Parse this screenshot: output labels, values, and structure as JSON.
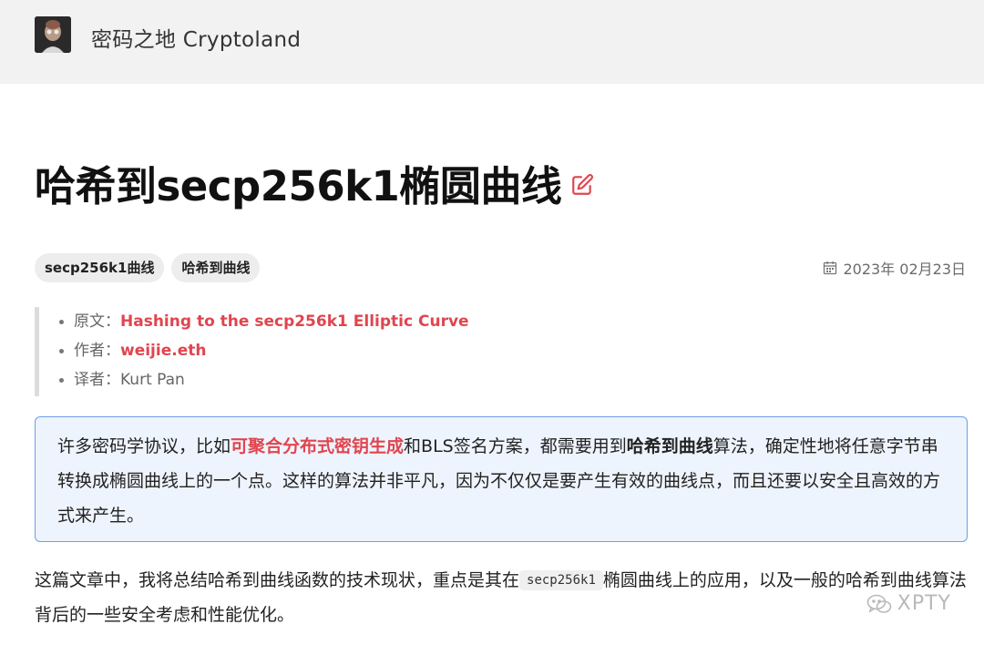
{
  "header": {
    "site_name": "密码之地 Cryptoland"
  },
  "article": {
    "title": "哈希到secp256k1椭圆曲线",
    "tags": [
      "secp256k1曲线",
      "哈希到曲线"
    ],
    "date": "2023年 02月23日",
    "meta": {
      "original_label": "原文：",
      "original_link": "Hashing to the secp256k1 Elliptic Curve",
      "author_label": "作者：",
      "author_link": "weijie.eth",
      "translator_label": "译者：",
      "translator_value": "Kurt Pan"
    },
    "callout": {
      "part1": "许多密码学协议，比如",
      "link": "可聚合分布式密钥生成",
      "part2": "和BLS签名方案，都需要用到",
      "bold": "哈希到曲线",
      "part3": "算法，确定性地将任意字节串转换成椭圆曲线上的一个点。这样的算法并非平凡，因为不仅仅是要产生有效的曲线点，而且还要以安全且高效的方式来产生。"
    },
    "paragraph": {
      "before": "这篇文章中，我将总结哈希到曲线函数的技术现状，重点是其在",
      "code": "secp256k1",
      "after": "椭圆曲线上的应用，以及一般的哈希到曲线算法背后的一些安全考虑和性能优化。"
    }
  },
  "watermark": {
    "text": "XPTY"
  },
  "colors": {
    "accent_red": "#e0454f",
    "callout_bg": "#eef4fd",
    "callout_border": "#6aa0e8",
    "header_bg": "#f2f2f2"
  },
  "icons": [
    "avatar",
    "edit-icon",
    "calendar-icon",
    "wechat-icon"
  ]
}
